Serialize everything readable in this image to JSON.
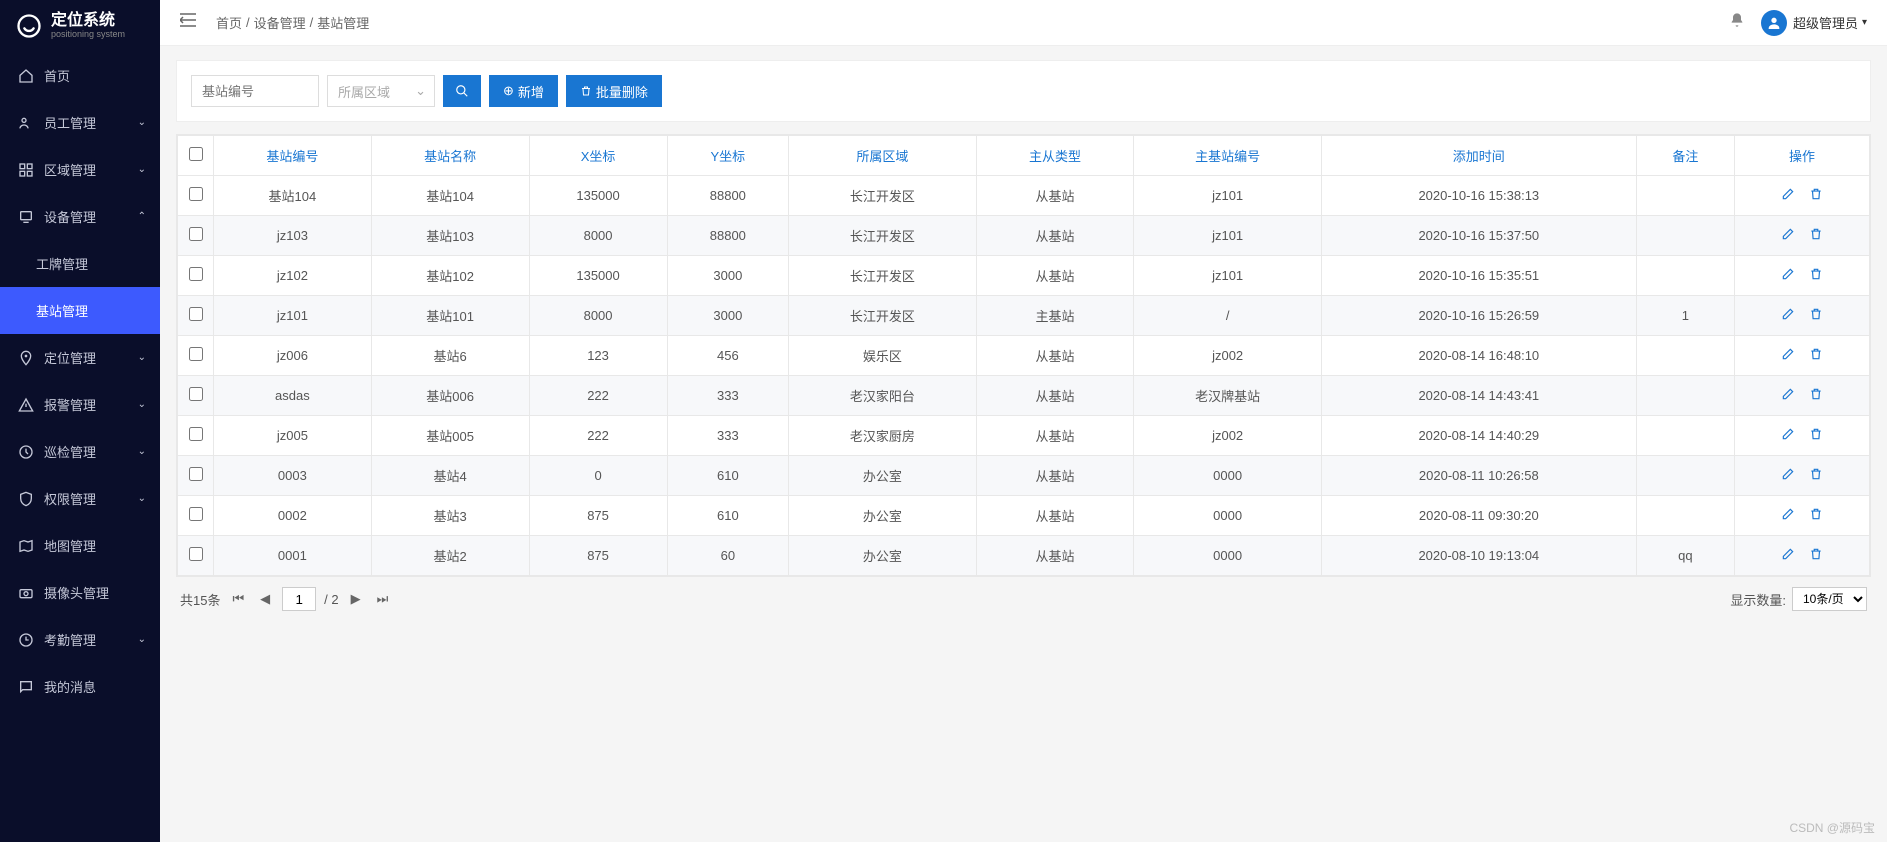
{
  "brand": {
    "name": "定位系统",
    "sub": "positioning system"
  },
  "nav": {
    "items": [
      {
        "icon": "home",
        "label": "首页"
      },
      {
        "icon": "users",
        "label": "员工管理",
        "chevron": "down"
      },
      {
        "icon": "grid",
        "label": "区域管理",
        "chevron": "down"
      },
      {
        "icon": "device",
        "label": "设备管理",
        "chevron": "up",
        "expanded": true
      },
      {
        "icon": "",
        "label": "工牌管理",
        "sub": true
      },
      {
        "icon": "",
        "label": "基站管理",
        "sub": true,
        "active": true
      },
      {
        "icon": "pin",
        "label": "定位管理",
        "chevron": "down"
      },
      {
        "icon": "alert",
        "label": "报警管理",
        "chevron": "down"
      },
      {
        "icon": "patrol",
        "label": "巡检管理",
        "chevron": "down"
      },
      {
        "icon": "shield",
        "label": "权限管理",
        "chevron": "down"
      },
      {
        "icon": "map",
        "label": "地图管理"
      },
      {
        "icon": "camera",
        "label": "摄像头管理"
      },
      {
        "icon": "clock",
        "label": "考勤管理",
        "chevron": "down"
      },
      {
        "icon": "msg",
        "label": "我的消息"
      }
    ]
  },
  "breadcrumb": {
    "items": [
      "首页",
      "设备管理",
      "基站管理"
    ],
    "sep": "/"
  },
  "user": {
    "name": "超级管理员"
  },
  "toolbar": {
    "search_placeholder": "基站编号",
    "area_placeholder": "所属区域",
    "add_label": "新增",
    "batch_delete_label": "批量删除"
  },
  "table": {
    "headers": [
      "基站编号",
      "基站名称",
      "X坐标",
      "Y坐标",
      "所属区域",
      "主从类型",
      "主基站编号",
      "添加时间",
      "备注",
      "操作"
    ],
    "rows": [
      {
        "id": "基站104",
        "name": "基站104",
        "x": "135000",
        "y": "88800",
        "area": "长江开发区",
        "type": "从基站",
        "master": "jz101",
        "time": "2020-10-16 15:38:13",
        "remark": ""
      },
      {
        "id": "jz103",
        "name": "基站103",
        "x": "8000",
        "y": "88800",
        "area": "长江开发区",
        "type": "从基站",
        "master": "jz101",
        "time": "2020-10-16 15:37:50",
        "remark": ""
      },
      {
        "id": "jz102",
        "name": "基站102",
        "x": "135000",
        "y": "3000",
        "area": "长江开发区",
        "type": "从基站",
        "master": "jz101",
        "time": "2020-10-16 15:35:51",
        "remark": ""
      },
      {
        "id": "jz101",
        "name": "基站101",
        "x": "8000",
        "y": "3000",
        "area": "长江开发区",
        "type": "主基站",
        "master": "/",
        "time": "2020-10-16 15:26:59",
        "remark": "1"
      },
      {
        "id": "jz006",
        "name": "基站6",
        "x": "123",
        "y": "456",
        "area": "娱乐区",
        "type": "从基站",
        "master": "jz002",
        "time": "2020-08-14 16:48:10",
        "remark": ""
      },
      {
        "id": "asdas",
        "name": "基站006",
        "x": "222",
        "y": "333",
        "area": "老汉家阳台",
        "type": "从基站",
        "master": "老汉牌基站",
        "time": "2020-08-14 14:43:41",
        "remark": ""
      },
      {
        "id": "jz005",
        "name": "基站005",
        "x": "222",
        "y": "333",
        "area": "老汉家厨房",
        "type": "从基站",
        "master": "jz002",
        "time": "2020-08-14 14:40:29",
        "remark": ""
      },
      {
        "id": "0003",
        "name": "基站4",
        "x": "0",
        "y": "610",
        "area": "办公室",
        "type": "从基站",
        "master": "0000",
        "time": "2020-08-11 10:26:58",
        "remark": ""
      },
      {
        "id": "0002",
        "name": "基站3",
        "x": "875",
        "y": "610",
        "area": "办公室",
        "type": "从基站",
        "master": "0000",
        "time": "2020-08-11 09:30:20",
        "remark": ""
      },
      {
        "id": "0001",
        "name": "基站2",
        "x": "875",
        "y": "60",
        "area": "办公室",
        "type": "从基站",
        "master": "0000",
        "time": "2020-08-10 19:13:04",
        "remark": "qq"
      }
    ]
  },
  "pager": {
    "total_label": "共15条",
    "current_page": "1",
    "total_pages": "/ 2",
    "size_label": "显示数量:",
    "size_value": "10条/页"
  },
  "watermark": "CSDN @源码宝"
}
